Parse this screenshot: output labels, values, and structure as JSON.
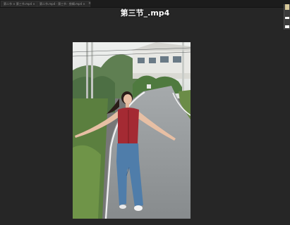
{
  "tabs": [
    {
      "label": "第二节 × 第三节.mp4 ×"
    },
    {
      "label": "第二节.mp4 · 第三节 · 剪辑.mp4 ×"
    }
  ],
  "video": {
    "title": "第三节_.mp4"
  },
  "colors": {
    "workspace": "#262626",
    "shirt": "#a42a33",
    "jeans": "#4f7daa",
    "road": "#8f9396"
  }
}
